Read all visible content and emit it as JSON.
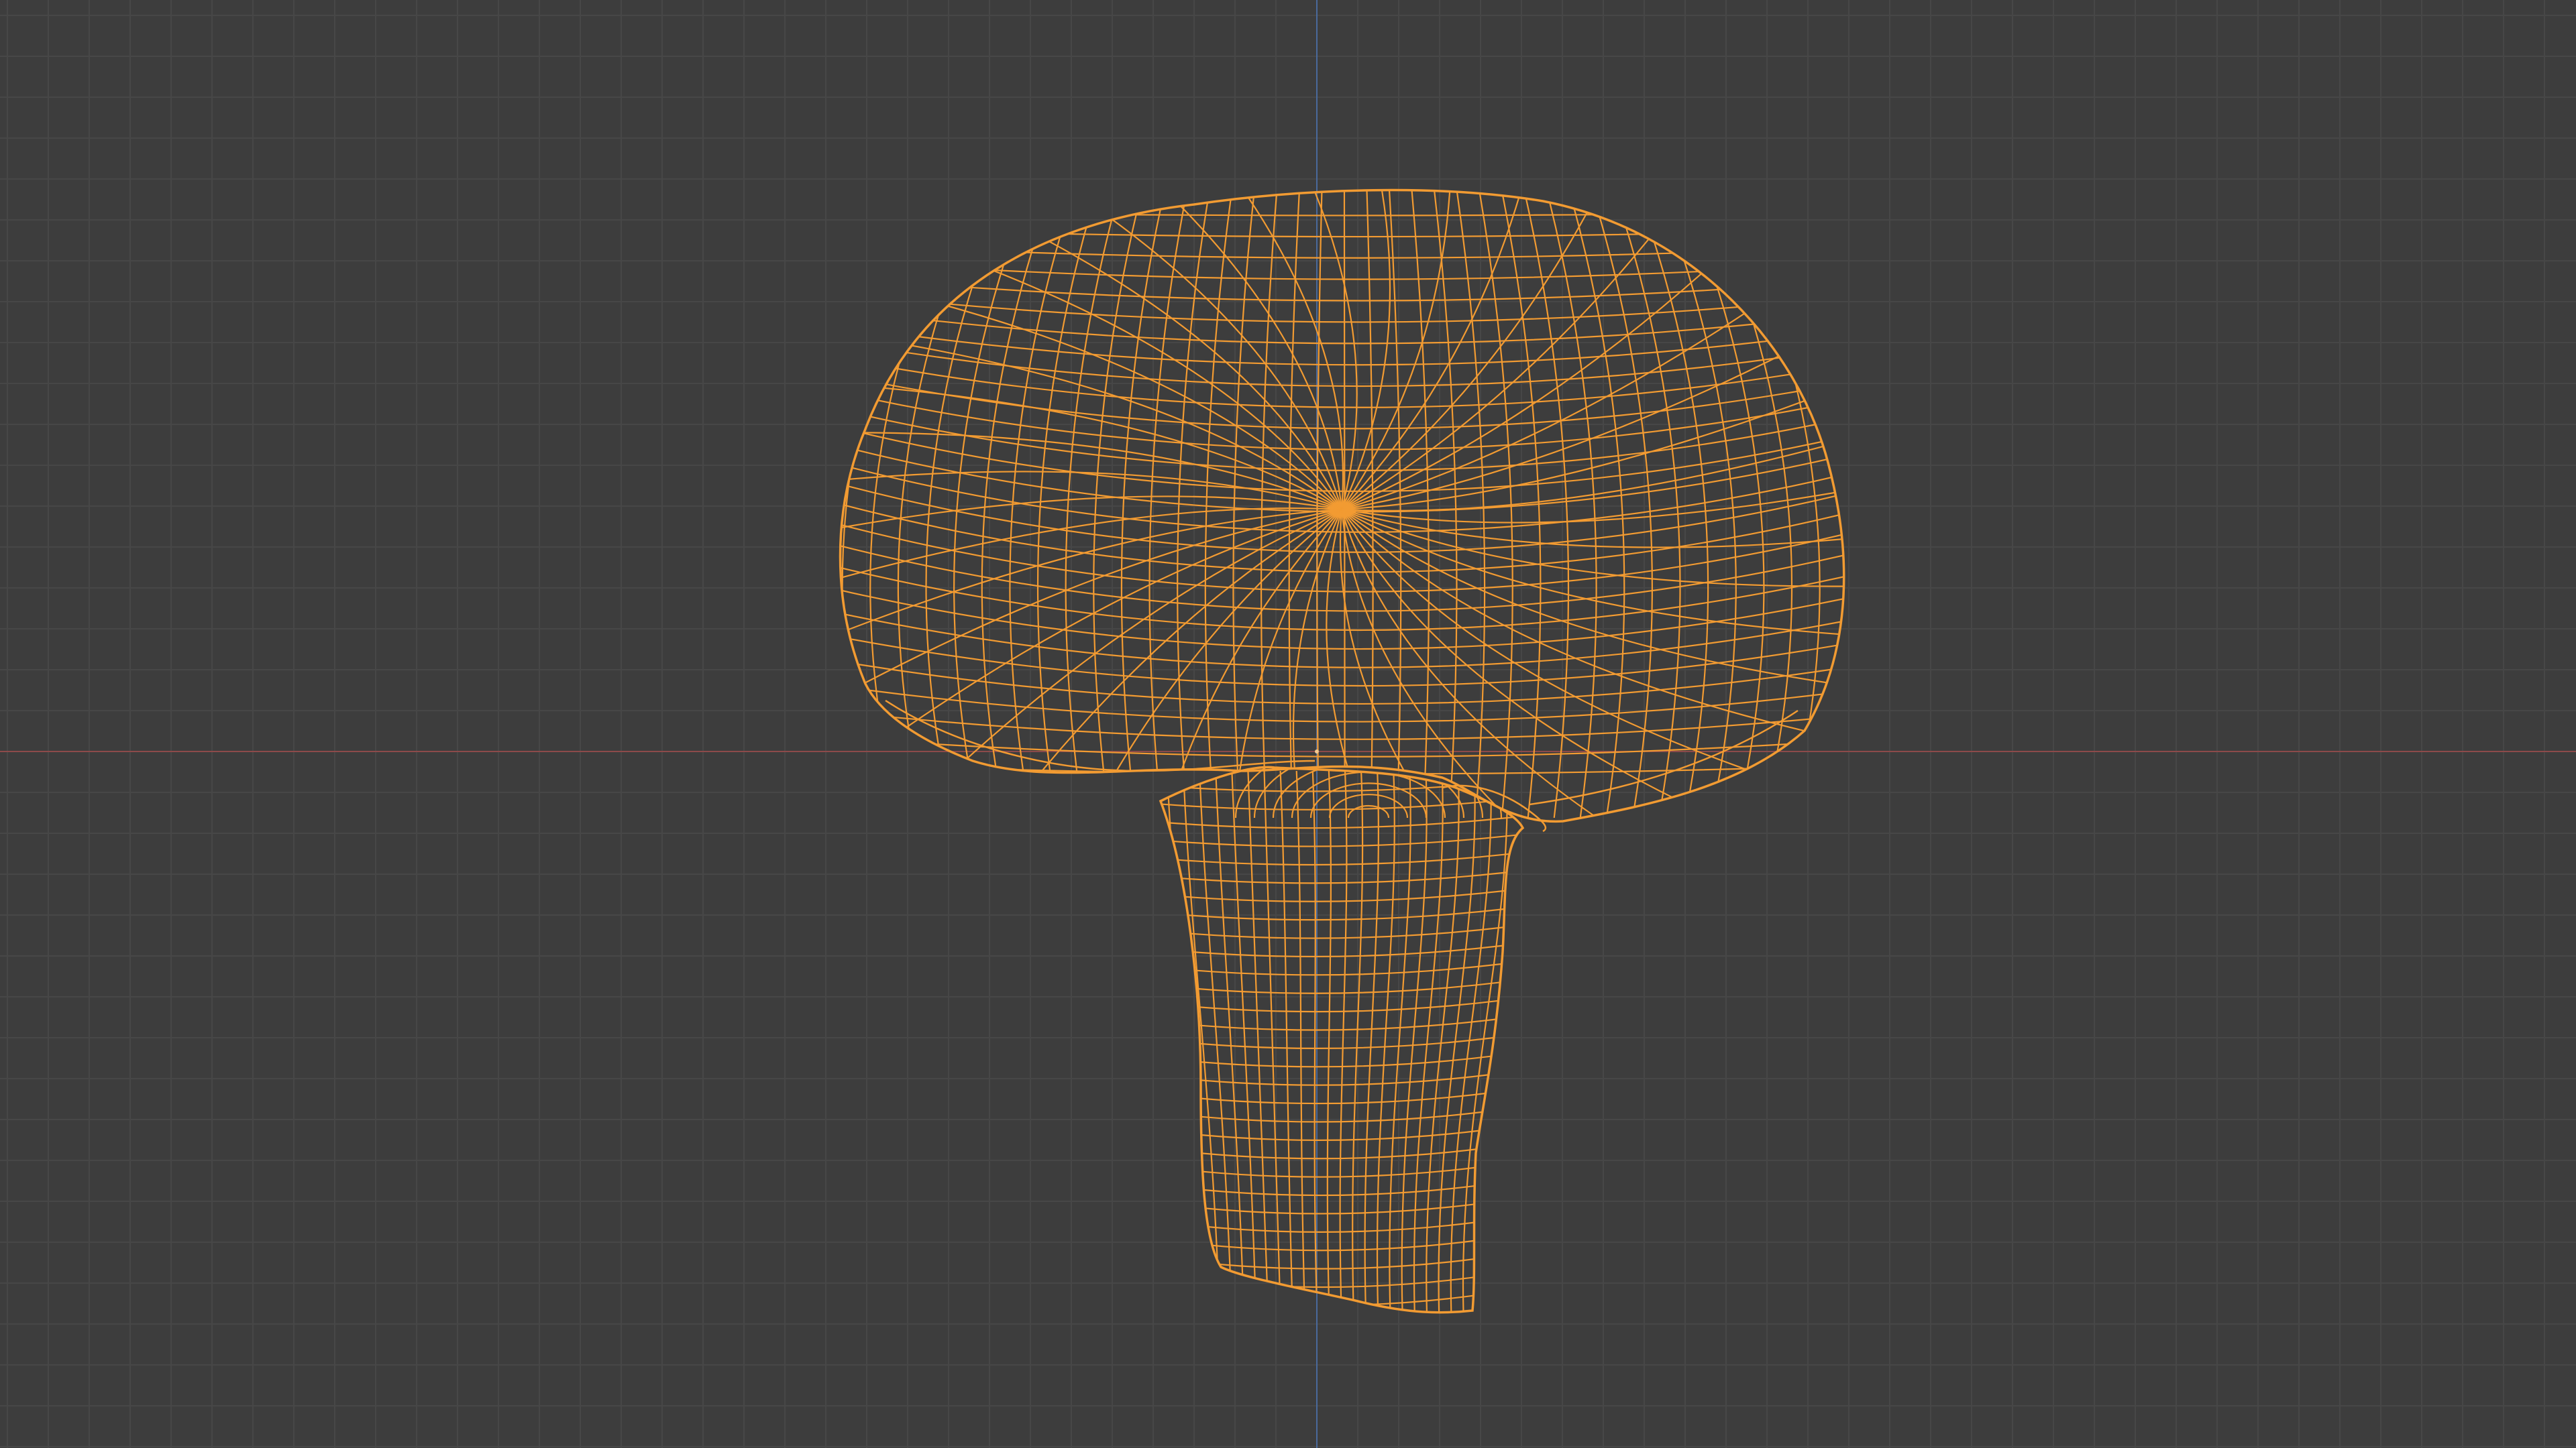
{
  "viewport": {
    "background_color": "#3d3d3d",
    "grid_minor_color": "#474747",
    "grid_major_color": "#4b4b4b",
    "x_axis_color": "#8c4a4a",
    "y_axis_color": "#4a6a9c",
    "wireframe_color": "#f29b32",
    "wireframe_dark_color": "#c47a28",
    "shading_mode": "wireframe",
    "object": "mushroom-mesh",
    "selected": true
  }
}
